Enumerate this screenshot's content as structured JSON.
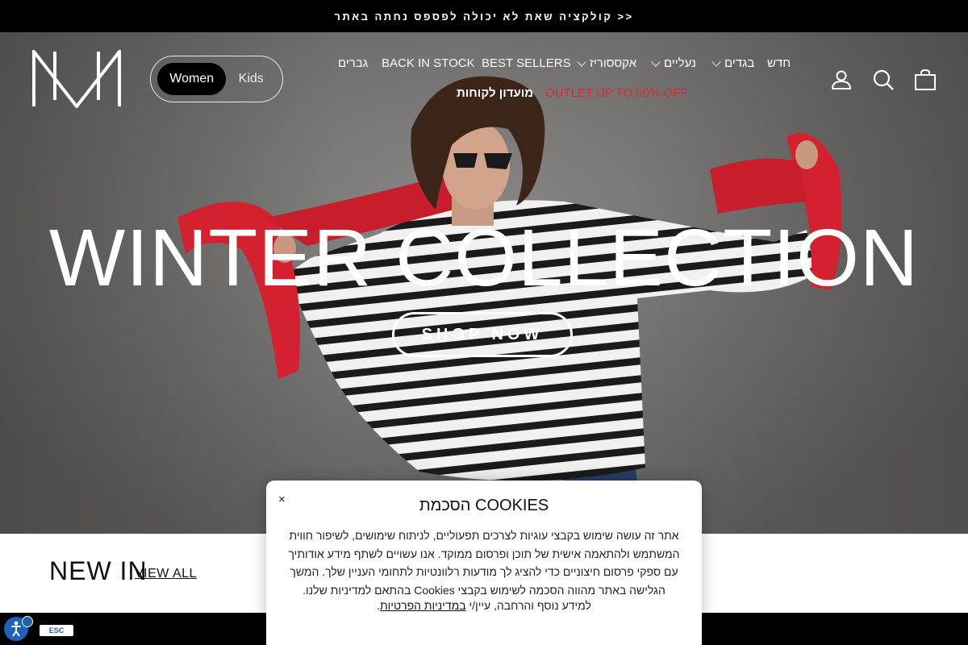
{
  "announcement": {
    "text": "קולקציה שאת לא יכולה לפספס נחתה באתר >>"
  },
  "gender_toggle": {
    "women": "Women",
    "kids": "Kids"
  },
  "nav": {
    "new": "חדש",
    "clothing": "בגדים",
    "shoes": "נעליים",
    "accessories": "אקססוריז",
    "best_sellers": "BEST SELLERS",
    "back_in_stock": "BACK IN STOCK",
    "men": "גברים",
    "outlet": "OUTLET UP TO 50% OFF",
    "club": "מועדון לקוחות"
  },
  "header_icons": [
    "account-icon",
    "search-icon",
    "cart-icon"
  ],
  "hero": {
    "headline": "WINTER COLLECTION",
    "cta": "SHOP NOW"
  },
  "section": {
    "title": "NEW IN",
    "view_all": "VIEW ALL"
  },
  "cookie": {
    "close": "×",
    "title": "הסכמת COOKIES",
    "body": "אתר זה עושה שימוש בקבצי עוגיות לצרכים תפעוליים, לניתוח שימושים, לשיפור חווית המשתמש ולהתאמה אישית של תוכן ופרסום ממוקד. אנו עשויים לשתף מידע אודותיך עם ספקי פרסום חיצוניים כדי להציג לך מודעות רלוונטיות לתחומי העניין שלך. המשך הגלישה באתר מהווה הסכמה לשימוש בקבצי Cookies בהתאם למדיניות שלנו.",
    "more_prefix": "למידע נוסף והרחבה, עיין/י ",
    "more_link": "במדיניות הפרטיות",
    "more_suffix": "."
  },
  "accessibility": {
    "esc_label": "ESC"
  },
  "colors": {
    "outlet_red": "#e3262b",
    "accessibility_blue": "#1f61b9",
    "sweater_red": "#d4212f"
  }
}
